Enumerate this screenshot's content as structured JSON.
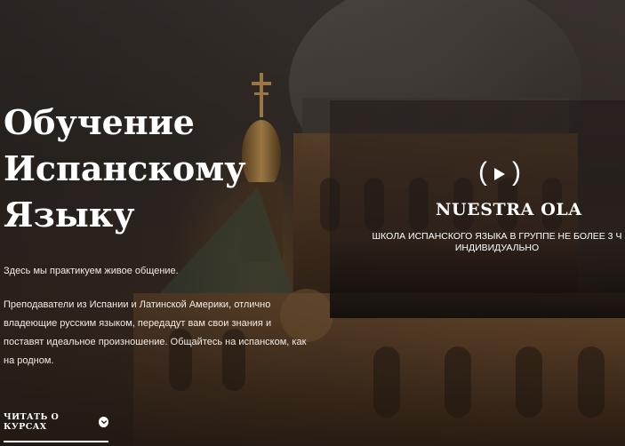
{
  "hero": {
    "title": "Обучение\nИспанскому\nЯзыку",
    "lead": "Здесь мы практикуем живое общение.",
    "description": "Преподаватели из Испании и Латинской Америки, отлично владеющие русским языком, передадут вам свои знания и поставят идеальное произношение. Общайтесь на испанском, как на родном.",
    "more_link": "ЧИТАТЬ О КУРСАХ",
    "more_icon": "chevron-down-icon"
  },
  "video": {
    "play_icon": "play-icon",
    "title": "NUESTRA OLA",
    "subtitle": "ШКОЛА ИСПАНСКОГО ЯЗЫКА В ГРУППЕ НЕ БОЛЕЕ 3 Ч\nИНДИВИДУАЛЬНО"
  },
  "colors": {
    "text": "#ffffff",
    "background": "#2b2420",
    "accent_gold": "#b8883e"
  }
}
